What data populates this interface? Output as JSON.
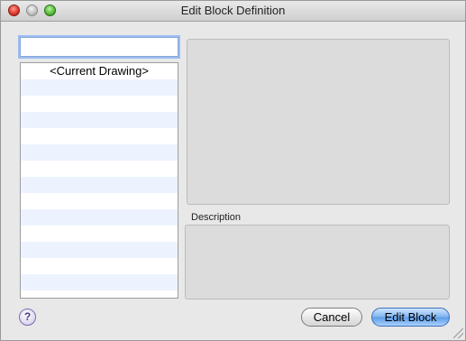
{
  "window": {
    "title": "Edit Block Definition"
  },
  "search": {
    "value": "",
    "placeholder": ""
  },
  "block_list": {
    "items": [
      "<Current Drawing>"
    ]
  },
  "description": {
    "label": "Description"
  },
  "buttons": {
    "help": "?",
    "cancel": "Cancel",
    "edit_block": "Edit Block"
  },
  "colors": {
    "accent": "#5b9be6",
    "list_stripe": "#edf3fe",
    "close": "#d8342a",
    "zoom": "#4fb833"
  }
}
